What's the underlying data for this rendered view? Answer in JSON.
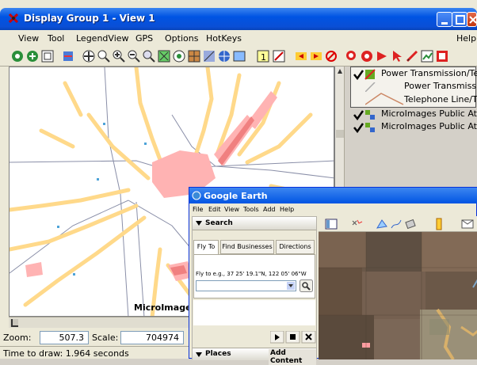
{
  "window": {
    "title": "Display Group 1 - View 1"
  },
  "menu": [
    "View",
    "Tool",
    "LegendView",
    "GPS",
    "Options",
    "HotKeys",
    "Help"
  ],
  "legend": {
    "items": [
      {
        "label": "Power Transmission/Te",
        "checked": true
      },
      {
        "label": "Power Transmiss",
        "checked": false
      },
      {
        "label": "Telephone Line/T",
        "checked": false
      },
      {
        "label": "MicroImages Public Atla",
        "checked": true
      },
      {
        "label": "MicroImages Public Atla",
        "checked": true
      }
    ]
  },
  "map": {
    "watermark": "MicroImages"
  },
  "status": {
    "zoom_label": "Zoom:",
    "zoom_value": "507.3",
    "scale_label": "Scale:",
    "scale_value": "704974",
    "draw_time": "Time to draw: 1.964 seconds"
  },
  "google_earth": {
    "title": "Google Earth",
    "menu": [
      "File",
      "Edit",
      "View",
      "Tools",
      "Add",
      "Help"
    ],
    "search_header": "Search",
    "tabs": [
      "Fly To",
      "Find Businesses",
      "Directions"
    ],
    "fly_to_hint": "Fly to e.g., 37 25' 19.1\"N, 122 05' 06\"W",
    "places_header": "Places",
    "add_content": "Add Content"
  },
  "colors": {
    "title_blue": "#0054e3",
    "urban": "#ffb3b3",
    "stream": "#ffd98a"
  }
}
